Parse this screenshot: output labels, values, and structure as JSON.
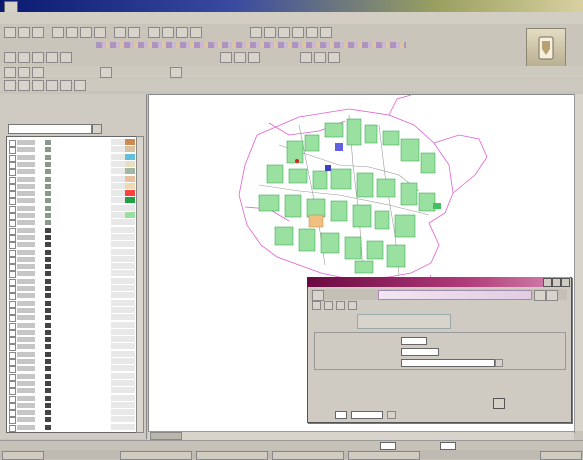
{
  "window": {
    "title": "",
    "colors": {
      "title_start": "#0a1a70",
      "title_end": "#d8d0a0"
    }
  },
  "menubar": {
    "items": []
  },
  "toolbars": {
    "labels": []
  },
  "layers": {
    "caption": "",
    "caption2": "",
    "filter_value": "",
    "rows": [
      {
        "swatch": "#8a9a8a",
        "big": "#d08a50"
      },
      {
        "swatch": "#8a9a8a",
        "big": "#d8c0a0"
      },
      {
        "swatch": "#8a9a8a",
        "big": "#60c0d8"
      },
      {
        "swatch": "#8a9a8a",
        "big": "#e8e0c0"
      },
      {
        "swatch": "#8a9a8a",
        "big": "#a0b8a0"
      },
      {
        "swatch": "#8a9a8a",
        "big": "#e8c0a0"
      },
      {
        "swatch": "#8a9a8a",
        "big": "#f0d8b0"
      },
      {
        "swatch": "#8a9a8a",
        "big": "#ff4040"
      },
      {
        "swatch": "#8a9a8a",
        "big": "#20a040"
      },
      {
        "swatch": "#8a9a8a",
        "big": "#e8e8e8"
      },
      {
        "swatch": "#8a9a8a",
        "big": "#9adfa0"
      },
      {
        "swatch": "#8a9a8a",
        "big": "#e8e8e8"
      },
      {
        "swatch": "#444444",
        "big": "#e8e8e8"
      },
      {
        "swatch": "#444444",
        "big": "#e8e8e8"
      },
      {
        "swatch": "#444444",
        "big": "#e8e8e8"
      },
      {
        "swatch": "#444444",
        "big": "#e8e8e8"
      },
      {
        "swatch": "#444444",
        "big": "#e8e8e8"
      },
      {
        "swatch": "#444444",
        "big": "#e8e8e8"
      },
      {
        "swatch": "#444444",
        "big": "#e8e8e8"
      },
      {
        "swatch": "#444444",
        "big": "#e8e8e8"
      },
      {
        "swatch": "#444444",
        "big": "#e8e8e8"
      },
      {
        "swatch": "#444444",
        "big": "#e8e8e8"
      },
      {
        "swatch": "#444444",
        "big": "#e8e8e8"
      },
      {
        "swatch": "#444444",
        "big": "#e8e8e8"
      },
      {
        "swatch": "#444444",
        "big": "#e8e8e8"
      },
      {
        "swatch": "#444444",
        "big": "#e8e8e8"
      },
      {
        "swatch": "#444444",
        "big": "#e8e8e8"
      },
      {
        "swatch": "#444444",
        "big": "#e8e8e8"
      },
      {
        "swatch": "#444444",
        "big": "#e8e8e8"
      },
      {
        "swatch": "#444444",
        "big": "#e8e8e8"
      },
      {
        "swatch": "#444444",
        "big": "#e8e8e8"
      },
      {
        "swatch": "#444444",
        "big": "#e8e8e8"
      },
      {
        "swatch": "#444444",
        "big": "#e8e8e8"
      },
      {
        "swatch": "#444444",
        "big": "#e8e8e8"
      },
      {
        "swatch": "#444444",
        "big": "#e8e8e8"
      },
      {
        "swatch": "#444444",
        "big": "#e8e8e8"
      },
      {
        "swatch": "#444444",
        "big": "#e8e8e8"
      },
      {
        "swatch": "#444444",
        "big": "#e8e8e8"
      },
      {
        "swatch": "#444444",
        "big": "#e8e8e8"
      },
      {
        "swatch": "#444444",
        "big": "#e8e8e8"
      }
    ]
  },
  "map": {
    "colors": {
      "boundary": "#e060d0",
      "parcel": "#20c040",
      "road": "#a0a0a0",
      "marker": "#4040c0"
    }
  },
  "dialog": {
    "heading": "",
    "fields": [
      {
        "label": "",
        "value": ""
      },
      {
        "label": "",
        "value": ""
      },
      {
        "label": "",
        "value": ""
      }
    ],
    "colors": {
      "title_start": "#6a0a40",
      "heading_text": "#3030c0"
    }
  },
  "statusbar": {
    "items": []
  },
  "taskbar": {
    "items": []
  }
}
